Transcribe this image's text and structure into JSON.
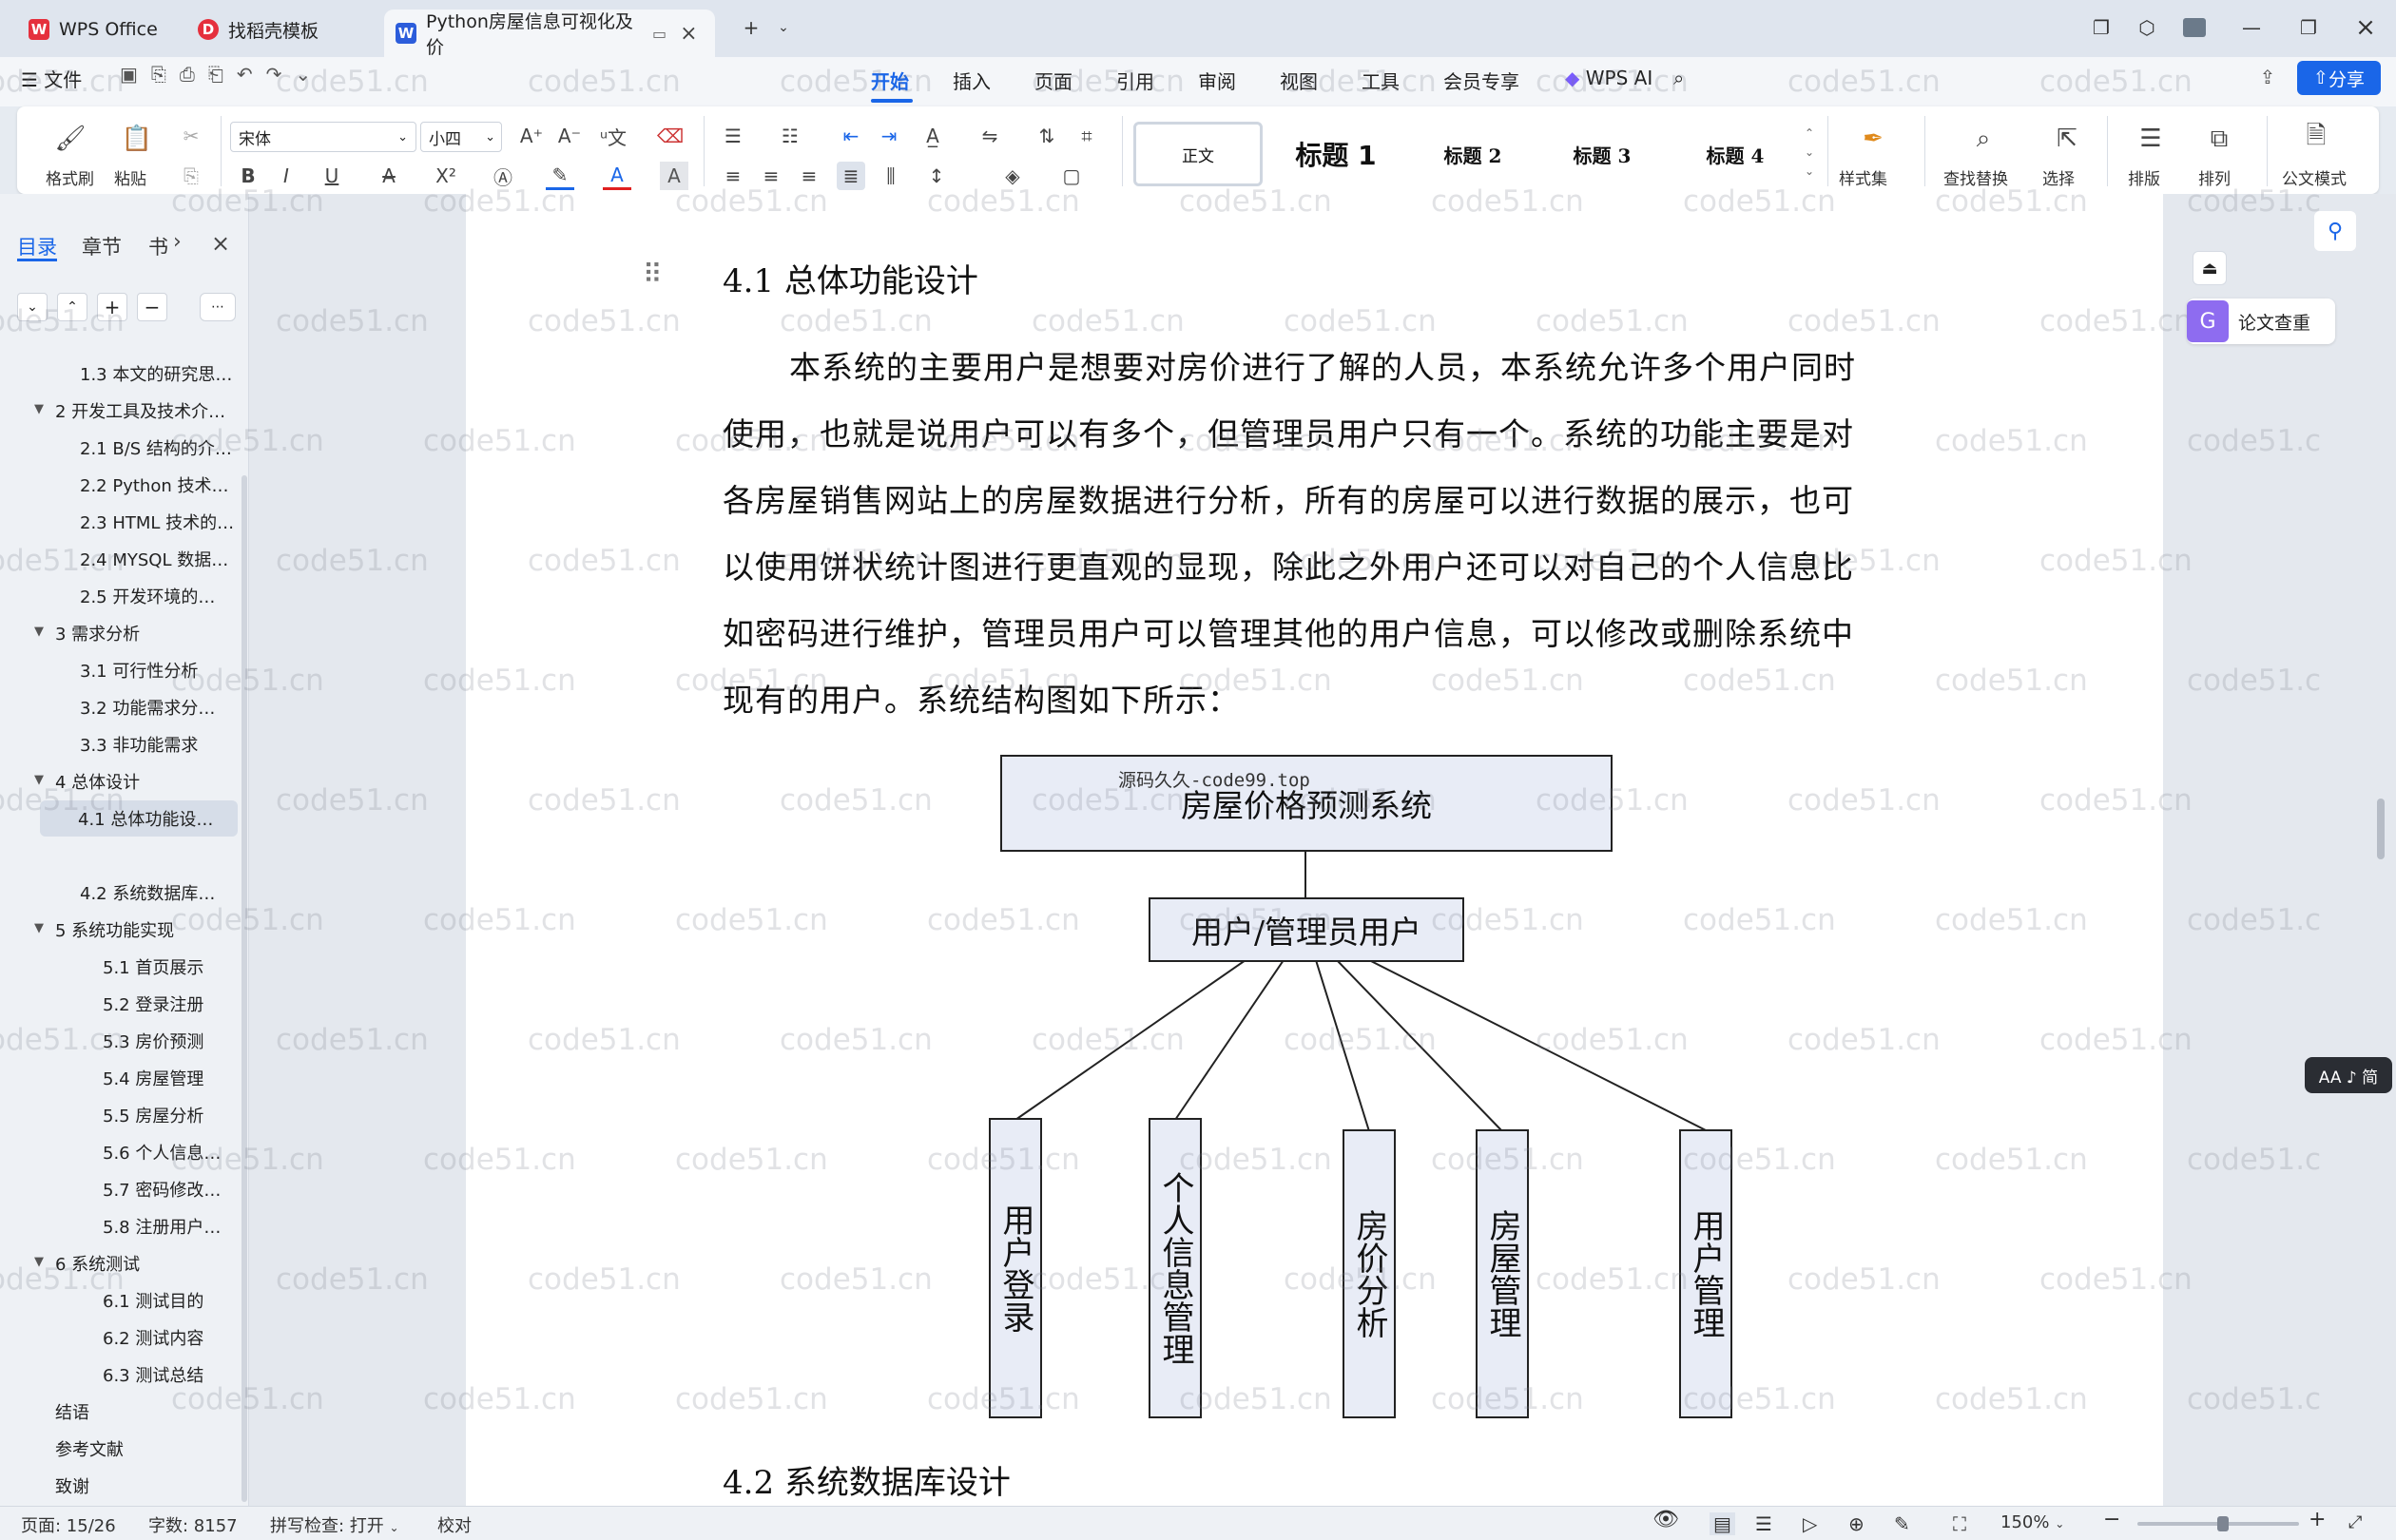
{
  "tabs": [
    {
      "label": "WPS Office",
      "logo": "W",
      "logo_color": "#e5303d"
    },
    {
      "label": "找稻壳模板",
      "logo": "D",
      "logo_color": "#e5303d"
    },
    {
      "label": "Python房屋信息可视化及价",
      "logo": "W",
      "logo_color": "#2c5ddb"
    }
  ],
  "menu": {
    "file": "文件",
    "items": [
      "开始",
      "插入",
      "页面",
      "引用",
      "审阅",
      "视图",
      "工具",
      "会员专享",
      "WPS AI"
    ],
    "active": "开始",
    "share": "分享"
  },
  "ribbon": {
    "format_painter": "格式刷",
    "paste": "粘贴",
    "font_name": "宋体",
    "font_size": "小四",
    "styles": [
      "正文",
      "标题 1",
      "标题 2",
      "标题 3",
      "标题 4"
    ],
    "style_set": "样式集",
    "find_replace": "查找替换",
    "select": "选择",
    "typeset": "排版",
    "arrange": "排列",
    "official_mode": "公文模式"
  },
  "nav": {
    "tabs": [
      "目录",
      "章节",
      "书"
    ],
    "active_tab": "目录",
    "toc": [
      {
        "text": "1.3 本文的研究思…",
        "level": 2
      },
      {
        "text": "2 开发工具及技术介…",
        "level": 1
      },
      {
        "text": "2.1 B/S 结构的介…",
        "level": 2
      },
      {
        "text": "2.2 Python 技术…",
        "level": 2
      },
      {
        "text": "2.3 HTML 技术的…",
        "level": 2
      },
      {
        "text": "2.4 MYSQL 数据…",
        "level": 2
      },
      {
        "text": "2.5 开发环境的…",
        "level": 2
      },
      {
        "text": "3 需求分析",
        "level": 1
      },
      {
        "text": "3.1 可行性分析",
        "level": 2
      },
      {
        "text": "3.2 功能需求分…",
        "level": 2
      },
      {
        "text": "3.3 非功能需求",
        "level": 2
      },
      {
        "text": "4 总体设计",
        "level": 1
      },
      {
        "text": "4.1 总体功能设…",
        "level": 2,
        "selected": true
      },
      {
        "text": "4.2 系统数据库…",
        "level": 2
      },
      {
        "text": "5 系统功能实现",
        "level": 1
      },
      {
        "text": "5.1 首页展示",
        "level": 3
      },
      {
        "text": "5.2 登录注册",
        "level": 3
      },
      {
        "text": "5.3 房价预测",
        "level": 3
      },
      {
        "text": "5.4 房屋管理",
        "level": 3
      },
      {
        "text": "5.5 房屋分析",
        "level": 3
      },
      {
        "text": "5.6 个人信息…",
        "level": 3
      },
      {
        "text": "5.7 密码修改…",
        "level": 3
      },
      {
        "text": "5.8 注册用户…",
        "level": 3
      },
      {
        "text": "6 系统测试",
        "level": 1
      },
      {
        "text": "6.1 测试目的",
        "level": 3
      },
      {
        "text": "6.2 测试内容",
        "level": 3
      },
      {
        "text": "6.3 测试总结",
        "level": 3
      },
      {
        "text": "结语",
        "level": 0
      },
      {
        "text": "参考文献",
        "level": 0
      },
      {
        "text": "致谢",
        "level": 0
      }
    ]
  },
  "document": {
    "heading_41": "4.1  总体功能设计",
    "paragraph_lines": [
      "本系统的主要用户是想要对房价进行了解的人员，本系统允许多个用户同时",
      "使用，也就是说用户可以有多个，但管理员用户只有一个。系统的功能主要是对",
      "各房屋销售网站上的房屋数据进行分析，所有的房屋可以进行数据的展示，也可",
      "以使用饼状统计图进行更直观的显现，除此之外用户还可以对自己的个人信息比",
      "如密码进行维护，管理员用户可以管理其他的用户信息，可以修改或删除系统中",
      "现有的用户。系统结构图如下所示："
    ],
    "diagram": {
      "overlay_text": "源码久久-code99.top",
      "root": "房屋价格预测系统",
      "middle": "用户/管理员用户",
      "leaves": [
        "用户登录",
        "个人信息管理",
        "房价分析",
        "房屋管理",
        "用户管理"
      ]
    },
    "heading_42": "4.2  系统数据库设计",
    "watermark": "code51.cn"
  },
  "right_panel": {
    "plagiarism_check": "论文查重",
    "font_toggle": "AA ♪ 简"
  },
  "status": {
    "page": "页面: 15/26",
    "words": "字数: 8157",
    "spellcheck": "拼写检查: 打开",
    "proofread": "校对",
    "zoom": "150%"
  }
}
